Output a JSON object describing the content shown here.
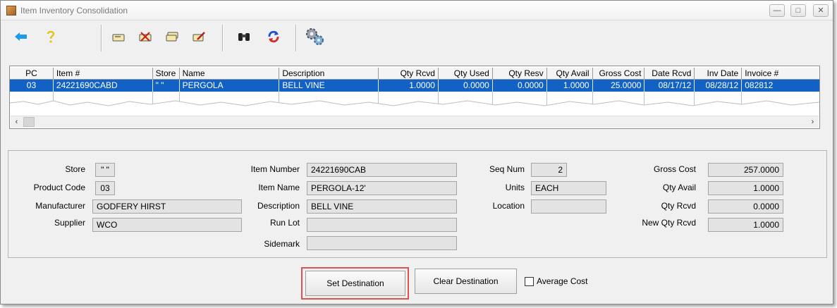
{
  "window": {
    "title": "Item Inventory Consolidation",
    "minimize": "—",
    "maximize": "□",
    "close": "✕"
  },
  "toolbar": {
    "icons": [
      "back-arrow-icon",
      "help-icon",
      "card-add-icon",
      "card-delete-icon",
      "card-stack-icon",
      "card-edit-icon",
      "binoculars-icon",
      "refresh-icon",
      "gears-icon"
    ]
  },
  "grid": {
    "columns": [
      "PC",
      "Item #",
      "Store",
      "Name",
      "Description",
      "Qty Rcvd",
      "Qty Used",
      "Qty Resv",
      "Qty Avail",
      "Gross Cost",
      "Date Rcvd",
      "Inv Date",
      "Invoice #"
    ],
    "rows": [
      [
        "03",
        "24221690CABD",
        "\" \"",
        "PERGOLA",
        "BELL VINE",
        "1.0000",
        "0.0000",
        "0.0000",
        "1.0000",
        "25.0000",
        "08/17/12",
        "08/28/12",
        "082812"
      ]
    ],
    "selection_color": "#1262c6"
  },
  "detail": {
    "store": {
      "label": "Store",
      "value": "\" \""
    },
    "product_code": {
      "label": "Product Code",
      "value": "03"
    },
    "manufacturer": {
      "label": "Manufacturer",
      "value": "GODFERY HIRST"
    },
    "supplier": {
      "label": "Supplier",
      "value": "WCO"
    },
    "item_number": {
      "label": "Item Number",
      "value": "24221690CAB"
    },
    "item_name": {
      "label": "Item Name",
      "value": "PERGOLA-12'"
    },
    "description": {
      "label": "Description",
      "value": "BELL VINE"
    },
    "run_lot": {
      "label": "Run Lot",
      "value": ""
    },
    "sidemark": {
      "label": "Sidemark",
      "value": ""
    },
    "seq_num": {
      "label": "Seq Num",
      "value": "2"
    },
    "units": {
      "label": "Units",
      "value": "EACH"
    },
    "location": {
      "label": "Location",
      "value": ""
    },
    "gross_cost": {
      "label": "Gross Cost",
      "value": "257.0000"
    },
    "qty_avail": {
      "label": "Qty Avail",
      "value": "1.0000"
    },
    "qty_rcvd": {
      "label": "Qty Rcvd",
      "value": "0.0000"
    },
    "new_qty_rcvd": {
      "label": "New Qty Rcvd",
      "value": "1.0000"
    }
  },
  "actions": {
    "set_destination": "Set Destination",
    "clear_destination": "Clear Destination",
    "average_cost": "Average Cost",
    "average_cost_checked": false,
    "highlight_color": "#d9534f"
  }
}
